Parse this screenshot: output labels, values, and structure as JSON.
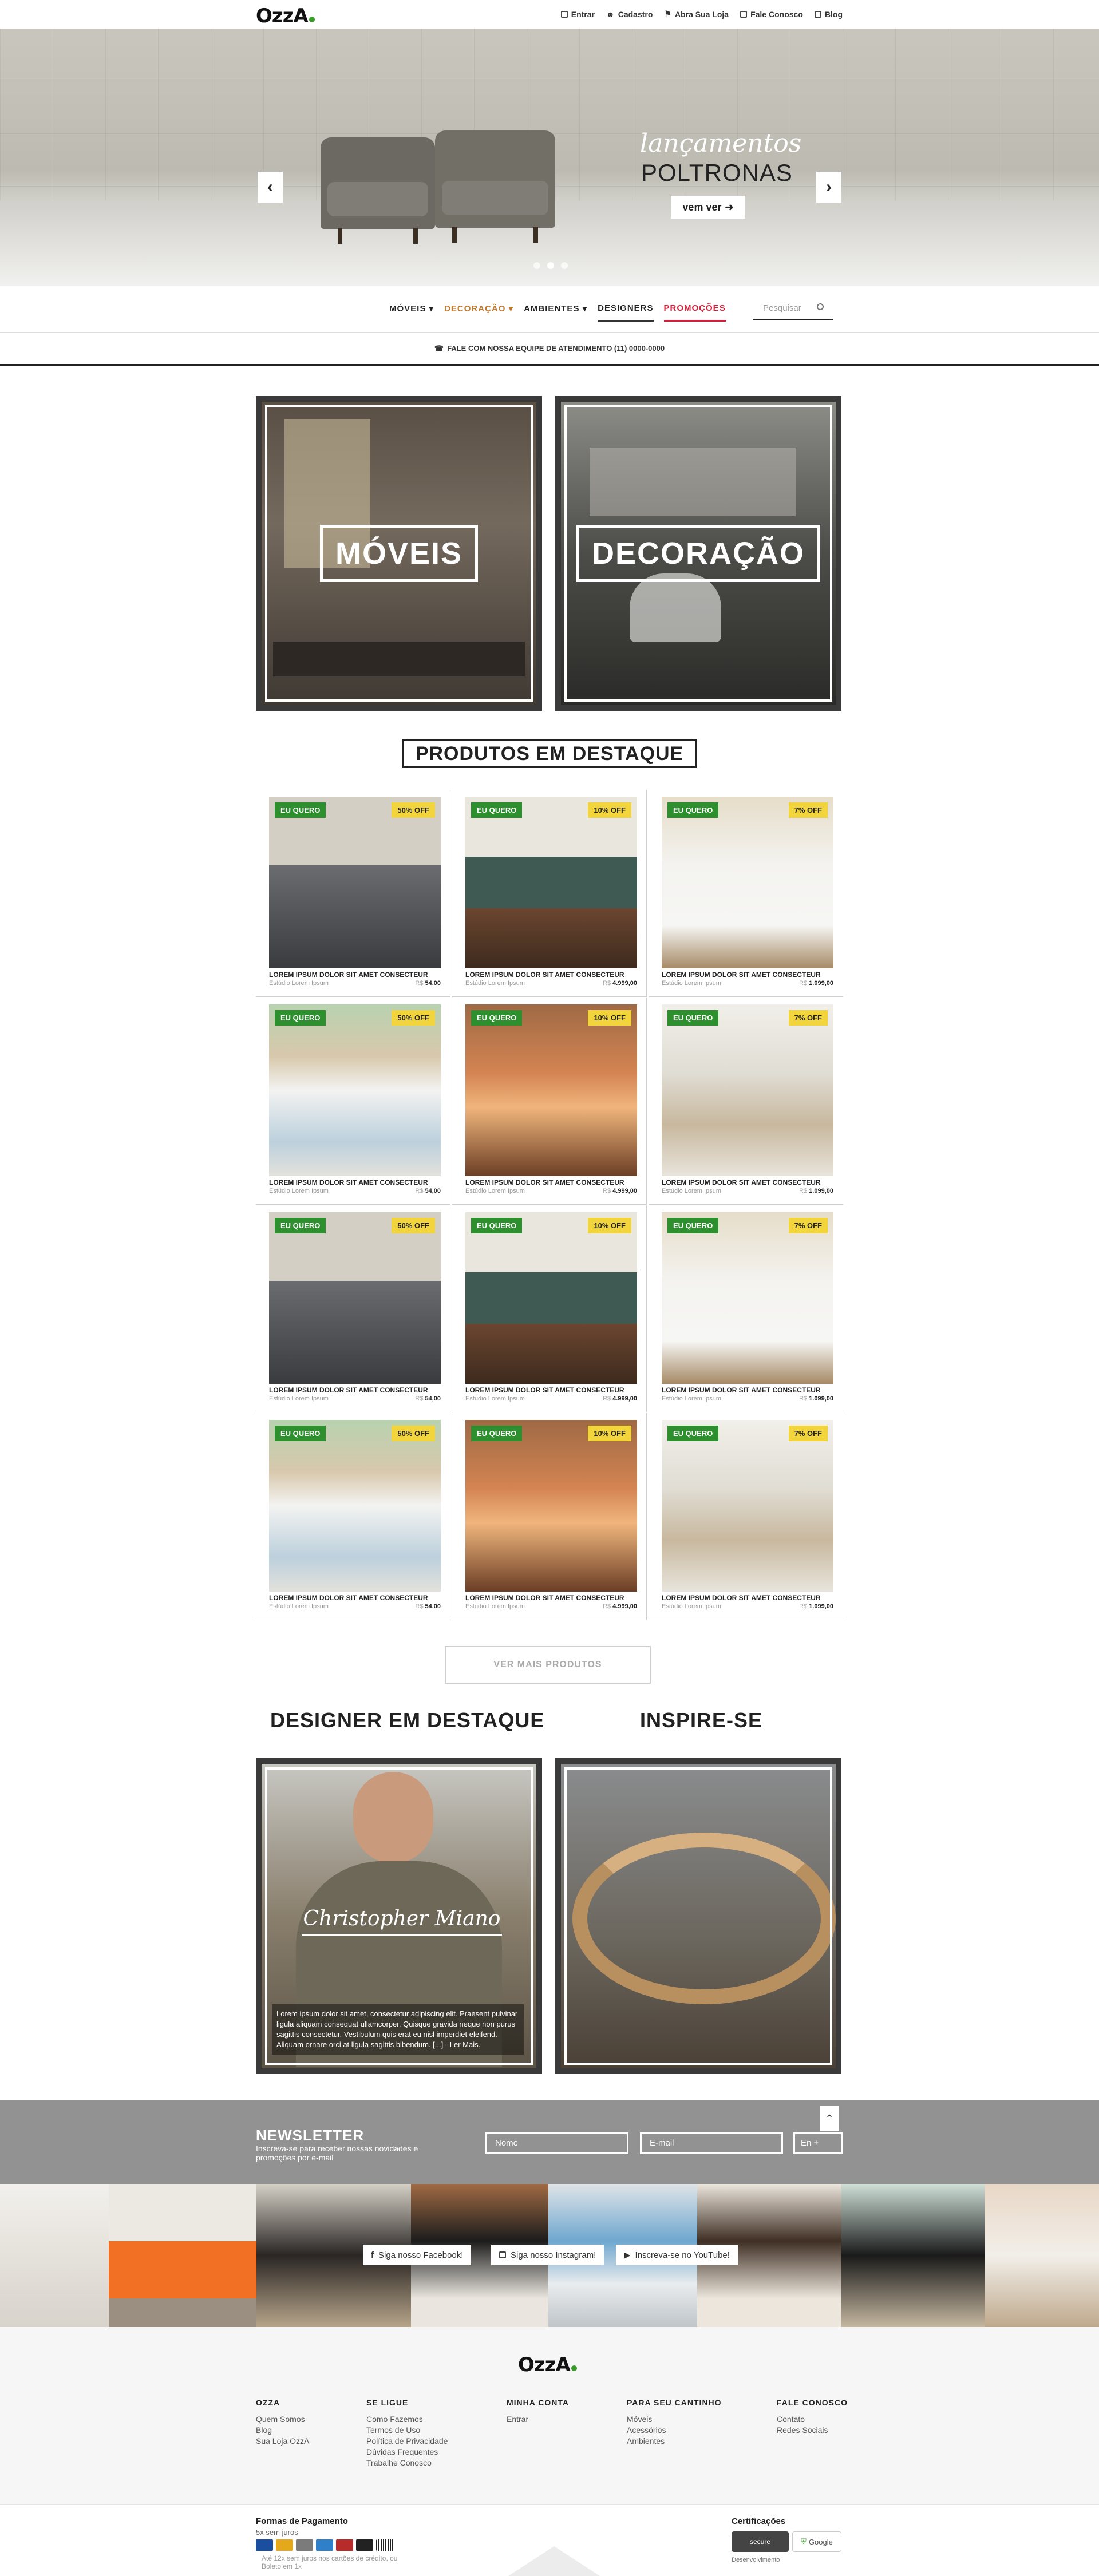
{
  "brand": {
    "logo": "OzzA"
  },
  "topbar": {
    "links": [
      "Entrar",
      "Cadastro",
      "Abra Sua Loja",
      "Fale Conosco",
      "Blog"
    ]
  },
  "hero": {
    "title_script": "lançamentos",
    "title_main": "POLTRONAS",
    "cta": "vem ver",
    "slide_count": 3,
    "active_slide": 2
  },
  "nav": {
    "items": [
      "MÓVEIS",
      "DECORAÇÃO",
      "AMBIENTES",
      "DESIGNERS",
      "PROMOÇÕES"
    ],
    "search_placeholder": "Pesquisar"
  },
  "phone": {
    "text": "FALE COM NOSSA EQUIPE DE ATENDIMENTO (11) 0000-0000"
  },
  "categories": [
    {
      "label": "MÓVEIS"
    },
    {
      "label": "DECORAÇÃO"
    }
  ],
  "products_section": {
    "title": "PRODUTOS EM DESTAQUE"
  },
  "products": [
    {
      "badge": "EU QUERO",
      "discount": "50% OFF",
      "title": "LOREM IPSUM DOLOR SIT AMET CONSECTEUR",
      "store": "Estúdio Lorem Ipsum",
      "currency": "R$",
      "price": "54,00",
      "image": "pillow"
    },
    {
      "badge": "EU QUERO",
      "discount": "10% OFF",
      "title": "LOREM IPSUM DOLOR SIT AMET CONSECTEUR",
      "store": "Estúdio Lorem Ipsum",
      "currency": "R$",
      "price": "4.999,00",
      "image": "sofa"
    },
    {
      "badge": "EU QUERO",
      "discount": "7% OFF",
      "title": "LOREM IPSUM DOLOR SIT AMET CONSECTEUR",
      "store": "Estúdio Lorem Ipsum",
      "currency": "R$",
      "price": "1.099,00",
      "image": "chairs"
    },
    {
      "badge": "EU QUERO",
      "discount": "50% OFF",
      "title": "LOREM IPSUM DOLOR SIT AMET CONSECTEUR",
      "store": "Estúdio Lorem Ipsum",
      "currency": "R$",
      "price": "54,00",
      "image": "bed"
    },
    {
      "badge": "EU QUERO",
      "discount": "10% OFF",
      "title": "LOREM IPSUM DOLOR SIT AMET CONSECTEUR",
      "store": "Estúdio Lorem Ipsum",
      "currency": "R$",
      "price": "4.999,00",
      "image": "lamps"
    },
    {
      "badge": "EU QUERO",
      "discount": "7% OFF",
      "title": "LOREM IPSUM DOLOR SIT AMET CONSECTEUR",
      "store": "Estúdio Lorem Ipsum",
      "currency": "R$",
      "price": "1.099,00",
      "image": "dining"
    },
    {
      "badge": "EU QUERO",
      "discount": "50% OFF",
      "title": "LOREM IPSUM DOLOR SIT AMET CONSECTEUR",
      "store": "Estúdio Lorem Ipsum",
      "currency": "R$",
      "price": "54,00",
      "image": "pillow"
    },
    {
      "badge": "EU QUERO",
      "discount": "10% OFF",
      "title": "LOREM IPSUM DOLOR SIT AMET CONSECTEUR",
      "store": "Estúdio Lorem Ipsum",
      "currency": "R$",
      "price": "4.999,00",
      "image": "sofa"
    },
    {
      "badge": "EU QUERO",
      "discount": "7% OFF",
      "title": "LOREM IPSUM DOLOR SIT AMET CONSECTEUR",
      "store": "Estúdio Lorem Ipsum",
      "currency": "R$",
      "price": "1.099,00",
      "image": "chairs"
    },
    {
      "badge": "EU QUERO",
      "discount": "50% OFF",
      "title": "LOREM IPSUM DOLOR SIT AMET CONSECTEUR",
      "store": "Estúdio Lorem Ipsum",
      "currency": "R$",
      "price": "54,00",
      "image": "bed"
    },
    {
      "badge": "EU QUERO",
      "discount": "10% OFF",
      "title": "LOREM IPSUM DOLOR SIT AMET CONSECTEUR",
      "store": "Estúdio Lorem Ipsum",
      "currency": "R$",
      "price": "4.999,00",
      "image": "lamps"
    },
    {
      "badge": "EU QUERO",
      "discount": "7% OFF",
      "title": "LOREM IPSUM DOLOR SIT AMET CONSECTEUR",
      "store": "Estúdio Lorem Ipsum",
      "currency": "R$",
      "price": "1.099,00",
      "image": "dining"
    }
  ],
  "more_button": "VER MAIS PRODUTOS",
  "designer": {
    "heading": "DESIGNER EM DESTAQUE",
    "name": "Christopher Miano",
    "bio": "Lorem ipsum dolor sit amet, consectetur adipiscing elit. Praesent pulvinar ligula aliquam consequat ullamcorper. Quisque gravida neque non purus sagittis consectetur. Vestibulum quis erat eu nisl imperdiet eleifend. Aliquam ornare orci at ligula sagittis bibendum. [...] - Ler Mais."
  },
  "inspire": {
    "heading": "INSPIRE-SE"
  },
  "newsletter": {
    "title": "NEWSLETTER",
    "subtitle": "Inscreva-se para receber nossas novidades e promoções por e-mail",
    "name_placeholder": "Nome",
    "email_placeholder": "E-mail",
    "submit": "En"
  },
  "social": {
    "facebook": "Siga nosso Facebook!",
    "instagram": "Siga nosso Instagram!",
    "youtube": "Inscreva-se no YouTube!"
  },
  "footer": {
    "columns": [
      {
        "title": "OZZA",
        "links": [
          "Quem Somos",
          "Blog",
          "Sua Loja OzzA"
        ]
      },
      {
        "title": "SE LIGUE",
        "links": [
          "Como Fazemos",
          "Termos de Uso",
          "Política de Privacidade",
          "Dúvidas Frequentes",
          "Trabalhe Conosco"
        ]
      },
      {
        "title": "MINHA CONTA",
        "links": [
          "Entrar"
        ]
      },
      {
        "title": "PARA SEU CANTINHO",
        "links": [
          "Móveis",
          "Acessórios",
          "Ambientes"
        ]
      },
      {
        "title": "FALE CONOSCO",
        "links": [
          "Contato",
          "Redes Sociais"
        ]
      }
    ]
  },
  "bottom": {
    "payment_title": "Formas de Pagamento",
    "payment_sub": "5x sem juros",
    "payment_note": "Até 12x sem juros nos cartões de crédito, ou Boleto em 1x",
    "cert_title": "Certificações",
    "secure": "secure",
    "google": "Google",
    "dev": "Desenvolvimento"
  },
  "colors": {
    "green_badge": "#2e8f2e",
    "yellow_badge": "#f2d43c",
    "promo_red": "#d0203a",
    "dark_border": "#3a3a3a",
    "newsletter_bg": "#929292"
  }
}
